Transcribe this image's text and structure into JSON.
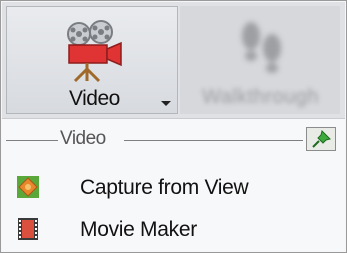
{
  "ribbon": {
    "video_button": {
      "label": "Video",
      "icon": "film-camera-icon"
    },
    "walkthrough_button": {
      "label": "Walkthrough",
      "icon": "footprints-icon"
    }
  },
  "panel": {
    "section_title": "Video",
    "pin_icon": "pin-icon",
    "items": [
      {
        "label": "Capture from View",
        "icon": "capture-view-icon"
      },
      {
        "label": "Movie Maker",
        "icon": "film-strip-icon"
      }
    ]
  },
  "colors": {
    "ribbon_bg": "#dfe1e5",
    "panel_bg": "#f7f8fa",
    "camera_red": "#e03434",
    "capture_green": "#5aa83a",
    "capture_orange": "#e8872c",
    "film_red": "#d9503f",
    "pin_green": "#3caa3c"
  }
}
